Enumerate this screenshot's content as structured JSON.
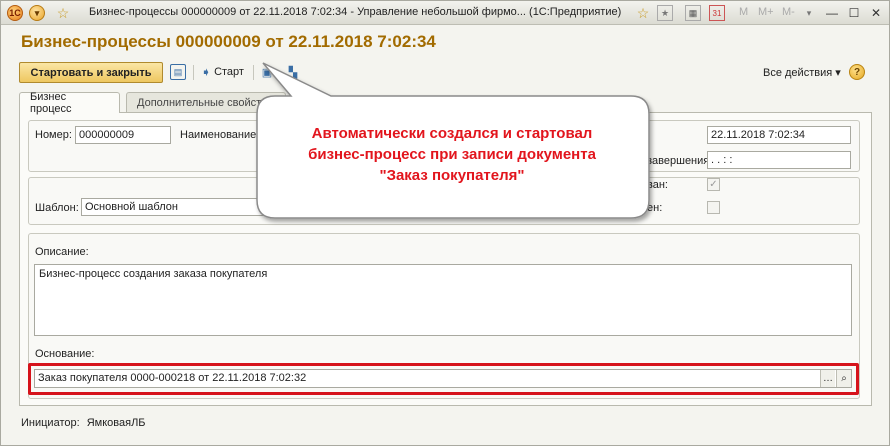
{
  "window": {
    "title": "Бизнес-процессы 000000009 от 22.11.2018 7:02:34 - Управление небольшой фирмо... (1С:Предприятие)",
    "memory_buttons": [
      "M",
      "M+",
      "M-"
    ]
  },
  "document": {
    "title": "Бизнес-процессы 000000009 от 22.11.2018 7:02:34"
  },
  "toolbar": {
    "start_and_close": "Стартовать и закрыть",
    "start": "Старт",
    "all_actions": "Все действия ▾",
    "help": "?"
  },
  "tabs": [
    {
      "label": "Бизнес процесс",
      "active": true
    },
    {
      "label": "Дополнительные свойства",
      "active": false
    }
  ],
  "form": {
    "number_label": "Номер:",
    "number_value": "000000009",
    "name_label": "Наименование",
    "date_value": "22.11.2018  7:02:34",
    "completion_label": "завершения:",
    "completion_value": " .  .       :  :",
    "started_label": "ван:",
    "started_checked": true,
    "completed_label": "ен:",
    "completed_checked": false,
    "template_label": "Шаблон:",
    "template_value": "Основной шаблон",
    "description_label": "Описание:",
    "description_value": "Бизнес-процесс создания заказа покупателя",
    "basis_label": "Основание:",
    "basis_value": "Заказ покупателя 0000-000218 от 22.11.2018 7:02:32",
    "initiator_label": "Инициатор:",
    "initiator_value": "ЯмковаяЛБ"
  },
  "callout": {
    "lines": [
      "Автоматически создался и стартовал",
      "бизнес-процесс при записи документа",
      "\"Заказ покупателя\""
    ]
  },
  "colors": {
    "title_accent": "#a26b00",
    "primary_button": "#eec760",
    "highlight": "#d6131b",
    "callout_text": "#e2151d"
  }
}
